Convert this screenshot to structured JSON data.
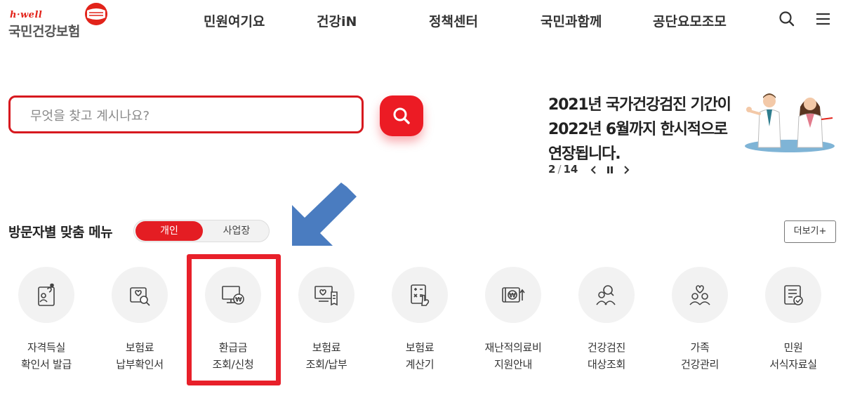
{
  "logo": {
    "tagline": "h·well",
    "name": "국민건강보험"
  },
  "nav": {
    "items": [
      "민원여기요",
      "건강iN",
      "정책센터",
      "국민과함께",
      "공단요모조모"
    ]
  },
  "search": {
    "placeholder": "무엇을 찾고 계시나요?",
    "value": ""
  },
  "banner": {
    "lines": [
      "2021년 국가건강검진 기간이",
      "2022년 6월까지 한시적으로",
      "연장됩니다."
    ],
    "page_current": "2",
    "page_total": "14"
  },
  "menu": {
    "title": "방문자별 맞춤 메뉴",
    "toggle": {
      "active": "개인",
      "inactive": "사업장"
    },
    "more": "더보기+",
    "items": [
      {
        "line1": "자격득실",
        "line2": "확인서 발급",
        "icon": "id-card-icon"
      },
      {
        "line1": "보험료",
        "line2": "납부확인서",
        "icon": "receipt-search-icon"
      },
      {
        "line1": "환급금",
        "line2": "조회/신청",
        "icon": "monitor-won-icon"
      },
      {
        "line1": "보험료",
        "line2": "조회/납부",
        "icon": "monitor-heart-bill-icon"
      },
      {
        "line1": "보험료",
        "line2": "계산기",
        "icon": "calculator-hand-icon"
      },
      {
        "line1": "재난적의료비",
        "line2": "지원안내",
        "icon": "wallet-won-icon"
      },
      {
        "line1": "건강검진",
        "line2": "대상조회",
        "icon": "people-search-icon"
      },
      {
        "line1": "가족",
        "line2": "건강관리",
        "icon": "family-heart-icon"
      },
      {
        "line1": "민원",
        "line2": "서식자료실",
        "icon": "document-check-icon"
      }
    ]
  },
  "colors": {
    "brand_red": "#e41d23",
    "arrow_blue": "#4a7cc0",
    "highlight_red": "#e8202a"
  }
}
